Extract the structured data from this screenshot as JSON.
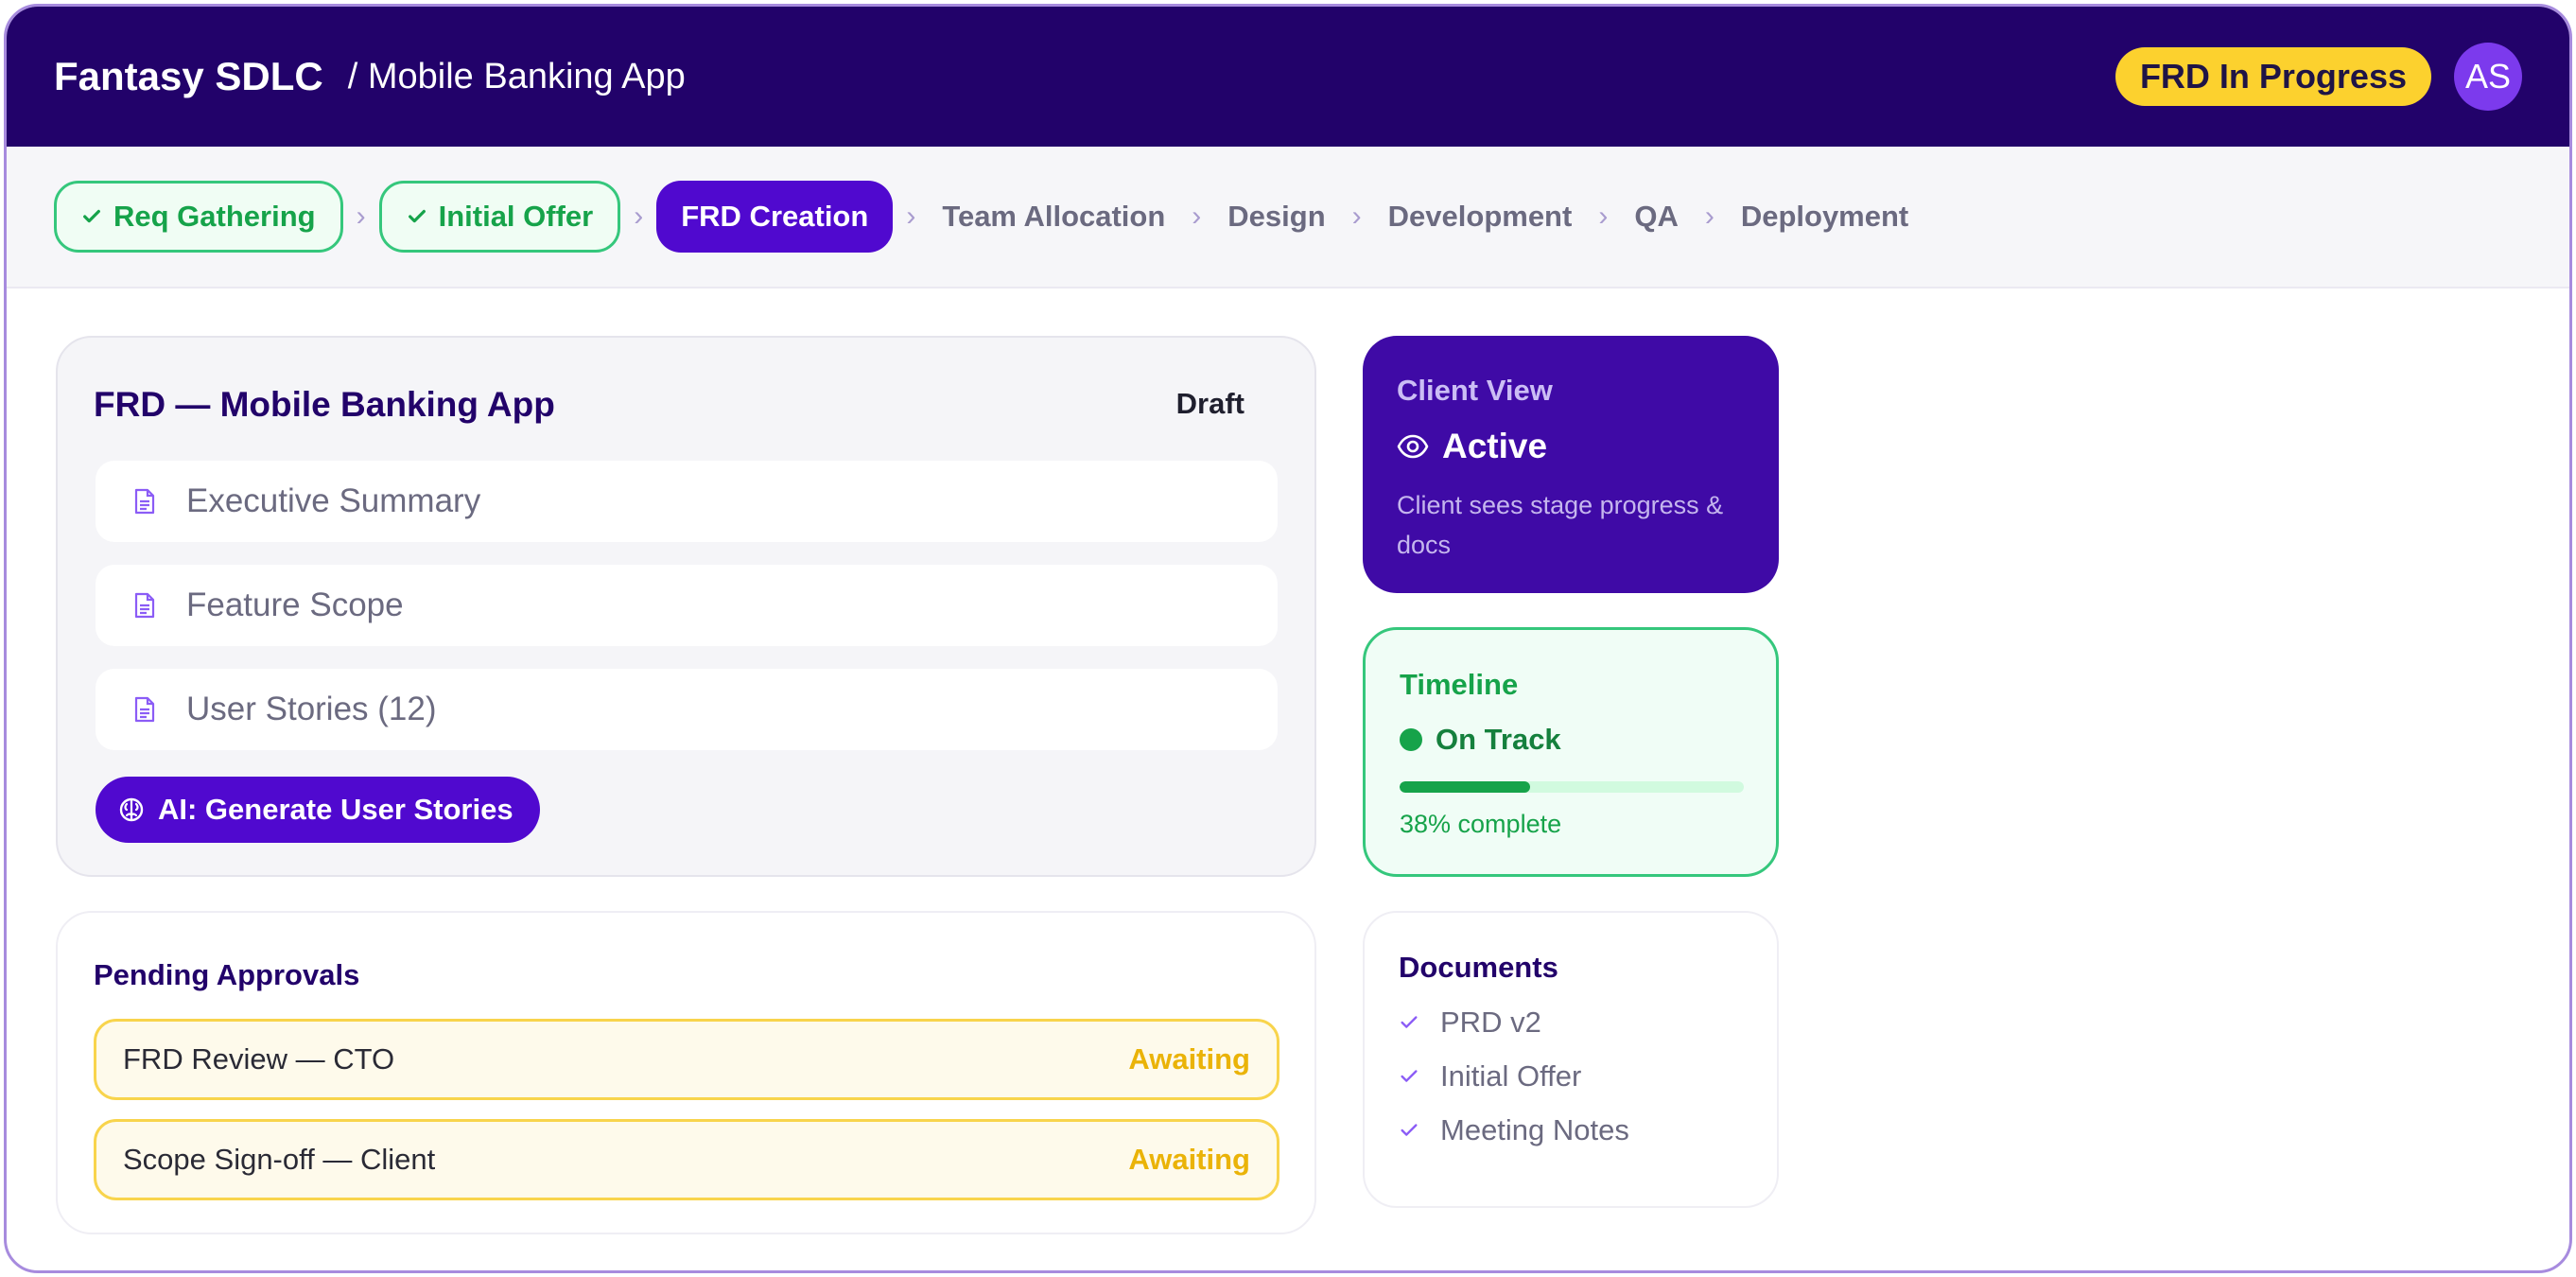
{
  "header": {
    "brand": "Fantasy SDLC",
    "breadcrumb": "/ Mobile Banking App",
    "status": "FRD In Progress",
    "avatar_initials": "AS",
    "colors": {
      "header_bg": "#22026a",
      "status_bg": "#fcd12e",
      "avatar_bg": "#7c3aed"
    }
  },
  "stepper": {
    "steps": [
      {
        "label": "Req Gathering",
        "state": "done"
      },
      {
        "label": "Initial Offer",
        "state": "done"
      },
      {
        "label": "FRD Creation",
        "state": "active"
      },
      {
        "label": "Team Allocation",
        "state": "pending"
      },
      {
        "label": "Design",
        "state": "pending"
      },
      {
        "label": "Development",
        "state": "pending"
      },
      {
        "label": "QA",
        "state": "pending"
      },
      {
        "label": "Deployment",
        "state": "pending"
      }
    ]
  },
  "frd": {
    "title": "FRD — Mobile Banking App",
    "badge": "Draft",
    "sections": [
      {
        "label": "Executive Summary",
        "icon": "document-icon"
      },
      {
        "label": "Feature Scope",
        "icon": "document-icon"
      },
      {
        "label": "User Stories (12)",
        "icon": "document-icon"
      }
    ],
    "ai_button": "AI: Generate User Stories",
    "ai_icon": "brain-icon"
  },
  "approvals": {
    "title": "Pending Approvals",
    "items": [
      {
        "label": "FRD Review — CTO",
        "status": "Awaiting"
      },
      {
        "label": "Scope Sign-off — Client",
        "status": "Awaiting"
      }
    ]
  },
  "client_view": {
    "title": "Client View",
    "status": "Active",
    "icon": "eye-icon",
    "description": "Client sees stage progress & docs"
  },
  "timeline": {
    "title": "Timeline",
    "status": "On Track",
    "progress": 0.38,
    "progress_label": "38% complete"
  },
  "documents": {
    "title": "Documents",
    "items": [
      "PRD v2",
      "Initial Offer",
      "Meeting Notes"
    ]
  }
}
